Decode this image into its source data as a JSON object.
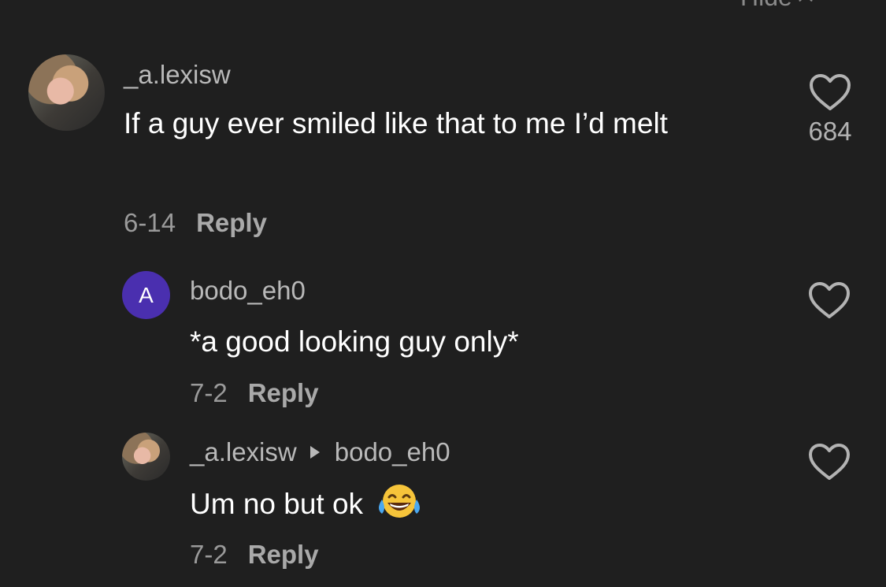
{
  "header": {
    "hide_label": "Hide"
  },
  "comments": [
    {
      "username": "_a.lexisw",
      "text": "If a guy ever smiled like that to me I’d melt",
      "date": "6-14",
      "reply_label": "Reply",
      "likes": "684"
    },
    {
      "avatar_letter": "A",
      "username": "bodo_eh0",
      "text": "*a good looking guy only*",
      "date": "7-2",
      "reply_label": "Reply"
    },
    {
      "username": "_a.lexisw",
      "reply_to": "bodo_eh0",
      "text": "Um no but ok",
      "emoji": "face-with-tears-of-joy",
      "date": "7-2",
      "reply_label": "Reply"
    }
  ],
  "colors": {
    "background": "#1f1f1f",
    "username": "#b9b9b9",
    "meta": "#9a9a9a",
    "avatar_letter_bg": "#4a2faf"
  }
}
